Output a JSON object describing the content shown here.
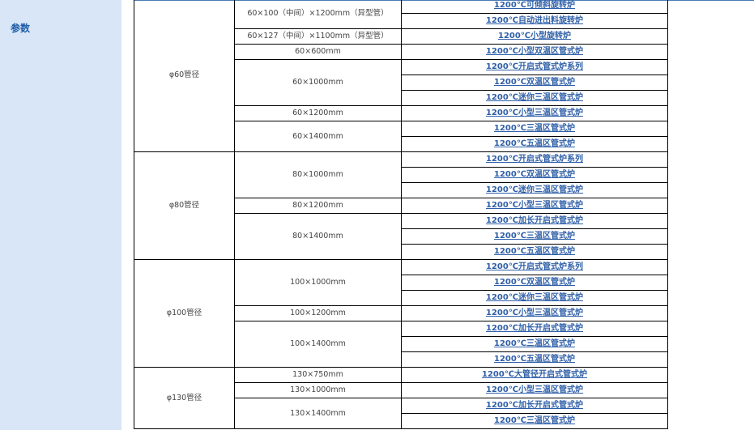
{
  "sidebar": {
    "label": "参数"
  },
  "groups": [
    {
      "diameter": "φ60管径",
      "sizes": [
        {
          "size": "60×100（中间）×1200mm（异型管）",
          "models": [
            "1200℃可倾斜旋转炉",
            "1200℃自动进出料旋转炉"
          ]
        },
        {
          "size": "60×127（中间）×1100mm（异型管）",
          "models": [
            "1200℃小型旋转炉"
          ]
        },
        {
          "size": "60×600mm",
          "models": [
            "1200℃小型双温区管式炉"
          ]
        },
        {
          "size": "60×1000mm",
          "models": [
            "1200℃开启式管式炉系列",
            "1200℃双温区管式炉",
            "1200℃迷你三温区管式炉"
          ]
        },
        {
          "size": "60×1200mm",
          "models": [
            "1200℃小型三温区管式炉"
          ]
        },
        {
          "size": "60×1400mm",
          "models": [
            "1200℃三温区管式炉",
            "1200℃五温区管式炉"
          ]
        }
      ]
    },
    {
      "diameter": "φ80管径",
      "sizes": [
        {
          "size": "80×1000mm",
          "models": [
            "1200℃开启式管式炉系列",
            "1200℃双温区管式炉",
            "1200℃迷你三温区管式炉"
          ]
        },
        {
          "size": "80×1200mm",
          "models": [
            "1200℃小型三温区管式炉"
          ]
        },
        {
          "size": "80×1400mm",
          "models": [
            "1200℃加长开启式管式炉",
            "1200℃三温区管式炉",
            "1200℃五温区管式炉"
          ]
        }
      ]
    },
    {
      "diameter": "φ100管径",
      "sizes": [
        {
          "size": "100×1000mm",
          "models": [
            "1200℃开启式管式炉系列",
            "1200℃双温区管式炉",
            "1200℃迷你三温区管式炉"
          ]
        },
        {
          "size": "100×1200mm",
          "models": [
            "1200℃小型三温区管式炉"
          ]
        },
        {
          "size": "100×1400mm",
          "models": [
            "1200℃加长开启式管式炉",
            "1200℃三温区管式炉",
            "1200℃五温区管式炉"
          ]
        }
      ]
    },
    {
      "diameter": "φ130管径",
      "sizes": [
        {
          "size": "130×750mm",
          "models": [
            "1200℃大管径开启式管式炉"
          ]
        },
        {
          "size": "130×1000mm",
          "models": [
            "1200℃小型三温区管式炉"
          ]
        },
        {
          "size": "130×1400mm",
          "models": [
            "1200℃加长开启式管式炉",
            "1200℃三温区管式炉"
          ]
        }
      ]
    }
  ]
}
